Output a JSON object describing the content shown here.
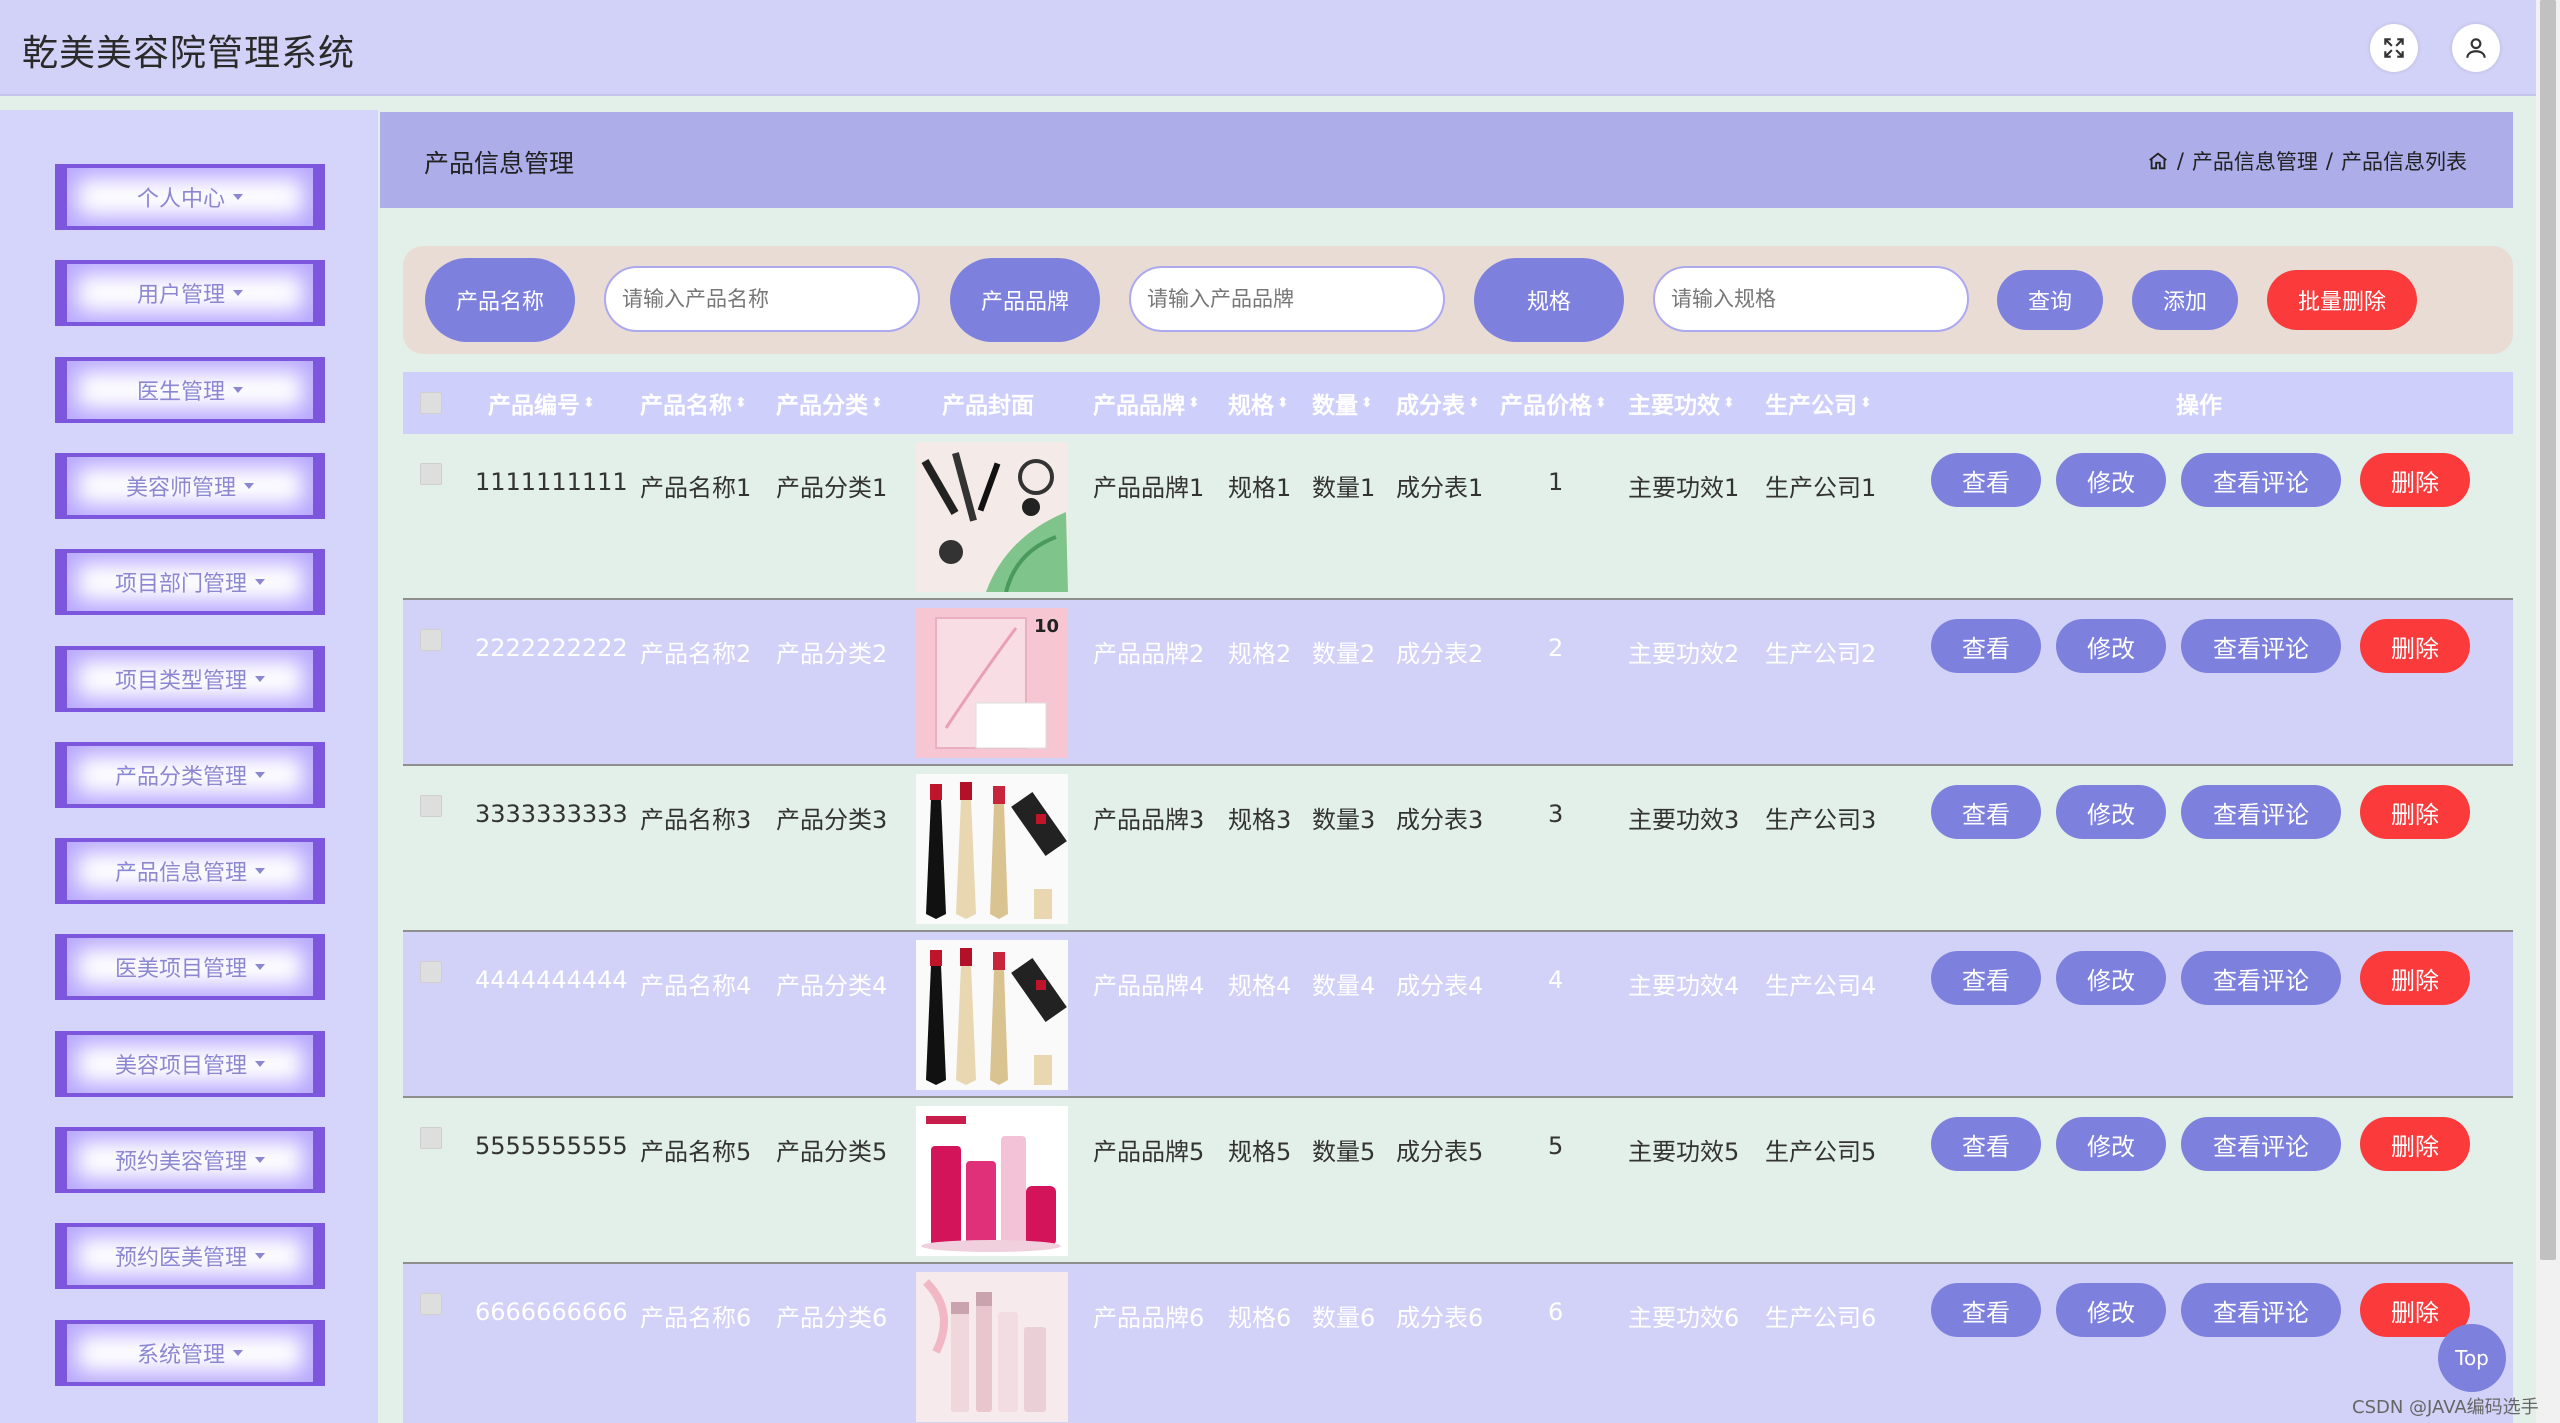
{
  "app": {
    "title": "乾美美容院管理系统"
  },
  "topbar": {
    "fullscreen_icon": "fullscreen-icon",
    "user_icon": "user-icon"
  },
  "sidebar": {
    "items": [
      {
        "label": "个人中心"
      },
      {
        "label": "用户管理"
      },
      {
        "label": "医生管理"
      },
      {
        "label": "美容师管理"
      },
      {
        "label": "项目部门管理"
      },
      {
        "label": "项目类型管理"
      },
      {
        "label": "产品分类管理"
      },
      {
        "label": "产品信息管理"
      },
      {
        "label": "医美项目管理"
      },
      {
        "label": "美容项目管理"
      },
      {
        "label": "预约美容管理"
      },
      {
        "label": "预约医美管理"
      },
      {
        "label": "系统管理"
      }
    ]
  },
  "page": {
    "title": "产品信息管理",
    "breadcrumb": {
      "home_icon": "home-icon",
      "sep1": "/",
      "level1": "产品信息管理",
      "sep2": "/",
      "level2": "产品信息列表"
    }
  },
  "search": {
    "name_label": "产品名称",
    "name_placeholder": "请输入产品名称",
    "brand_label": "产品品牌",
    "brand_placeholder": "请输入产品品牌",
    "spec_label": "规格",
    "spec_placeholder": "请输入规格",
    "query_button": "查询",
    "add_button": "添加",
    "batch_delete_button": "批量删除"
  },
  "table": {
    "columns": {
      "code": "产品编号",
      "name": "产品名称",
      "category": "产品分类",
      "cover": "产品封面",
      "brand": "产品品牌",
      "spec": "规格",
      "qty": "数量",
      "ingredients": "成分表",
      "price": "产品价格",
      "effect": "主要功效",
      "maker": "生产公司",
      "actions": "操作"
    },
    "sort_glyph": "⬍",
    "actions": {
      "view": "查看",
      "edit": "修改",
      "reviews": "查看评论",
      "delete": "删除"
    },
    "rows": [
      {
        "code": "1111111111",
        "name": "产品名称1",
        "category": "产品分类1",
        "brand": "产品品牌1",
        "spec": "规格1",
        "qty": "数量1",
        "ingredients": "成分表1",
        "price": "1",
        "effect": "主要功效1",
        "maker": "生产公司1"
      },
      {
        "code": "2222222222",
        "name": "产品名称2",
        "category": "产品分类2",
        "brand": "产品品牌2",
        "spec": "规格2",
        "qty": "数量2",
        "ingredients": "成分表2",
        "price": "2",
        "effect": "主要功效2",
        "maker": "生产公司2"
      },
      {
        "code": "3333333333",
        "name": "产品名称3",
        "category": "产品分类3",
        "brand": "产品品牌3",
        "spec": "规格3",
        "qty": "数量3",
        "ingredients": "成分表3",
        "price": "3",
        "effect": "主要功效3",
        "maker": "生产公司3"
      },
      {
        "code": "4444444444",
        "name": "产品名称4",
        "category": "产品分类4",
        "brand": "产品品牌4",
        "spec": "规格4",
        "qty": "数量4",
        "ingredients": "成分表4",
        "price": "4",
        "effect": "主要功效4",
        "maker": "生产公司4"
      },
      {
        "code": "5555555555",
        "name": "产品名称5",
        "category": "产品分类5",
        "brand": "产品品牌5",
        "spec": "规格5",
        "qty": "数量5",
        "ingredients": "成分表5",
        "price": "5",
        "effect": "主要功效5",
        "maker": "生产公司5"
      },
      {
        "code": "6666666666",
        "name": "产品名称6",
        "category": "产品分类6",
        "brand": "产品品牌6",
        "spec": "规格6",
        "qty": "数量6",
        "ingredients": "成分表6",
        "price": "6",
        "effect": "主要功效6",
        "maker": "生产公司6"
      }
    ]
  },
  "misc": {
    "top_button": "Top",
    "watermark": "CSDN @JAVA编码选手"
  }
}
